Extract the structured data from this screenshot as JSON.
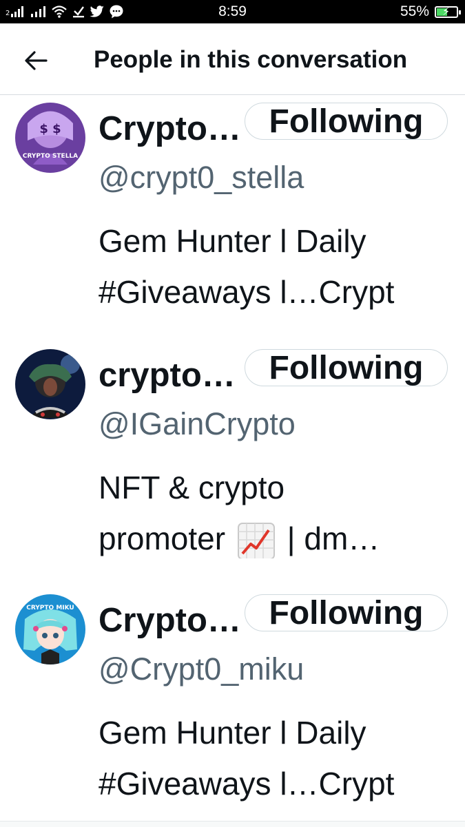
{
  "status_bar": {
    "time": "8:59",
    "battery_percent": "55%",
    "battery_level": 0.55,
    "icons": [
      "signal-icon",
      "signal-icon",
      "wifi-icon",
      "download-icon",
      "twitter-icon",
      "message-icon"
    ]
  },
  "header": {
    "title": "People in this conversation",
    "back_icon": "arrow-left-icon"
  },
  "people": [
    {
      "name": "Crypto…",
      "handle": "@crypt0_stella",
      "follow_label": "Following",
      "bio_line1": "Gem Hunter l Daily",
      "bio_line2": "#Giveaways  l…Crypt",
      "avatar_text_top": "$ $",
      "avatar_text": "CRYPTO STELLA"
    },
    {
      "name": "crypto…",
      "handle": "@IGainCrypto",
      "follow_label": "Following",
      "bio_line1": "NFT & crypto",
      "bio_line2a": "promoter",
      "bio_line2b": "| dm…"
    },
    {
      "name": "Crypto…",
      "handle": "@Crypt0_miku",
      "follow_label": "Following",
      "bio_line1": "Gem Hunter l Daily",
      "bio_line2": "#Giveaways  l…Crypt",
      "avatar_text": "CRYPTO MIKU"
    }
  ],
  "colors": {
    "text": "#0f1419",
    "secondary": "#536471",
    "border": "#cfd9de",
    "statusbar": "#000000"
  }
}
